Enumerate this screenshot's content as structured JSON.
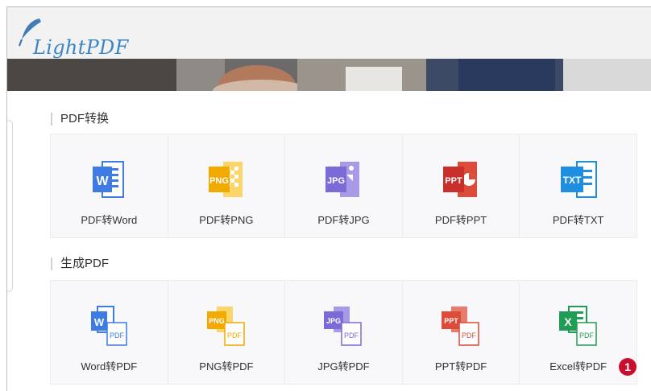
{
  "app": {
    "logo_text": "LightPDF"
  },
  "sections": [
    {
      "title": "PDF转换",
      "tiles": [
        {
          "label": "PDF转Word",
          "icon": "word-doc-icon",
          "color": "#3e7be3",
          "tag": "W"
        },
        {
          "label": "PDF转PNG",
          "icon": "png-image-icon",
          "color": "#f2a900",
          "tag": "PNG"
        },
        {
          "label": "PDF转JPG",
          "icon": "jpg-image-icon",
          "color": "#7b6bd6",
          "tag": "JPG"
        },
        {
          "label": "PDF转PPT",
          "icon": "ppt-slide-icon",
          "color": "#dd4b39",
          "tag": "PPT"
        },
        {
          "label": "PDF转TXT",
          "icon": "txt-file-icon",
          "color": "#1e8fe0",
          "tag": "TXT"
        }
      ]
    },
    {
      "title": "生成PDF",
      "tiles": [
        {
          "label": "Word转PDF",
          "icon": "word-to-pdf-icon",
          "color": "#3e7be3",
          "tag": "W",
          "sub": "PDF"
        },
        {
          "label": "PNG转PDF",
          "icon": "png-to-pdf-icon",
          "color": "#f2a900",
          "tag": "PNG",
          "sub": "PDF"
        },
        {
          "label": "JPG转PDF",
          "icon": "jpg-to-pdf-icon",
          "color": "#7b6bd6",
          "tag": "JPG",
          "sub": "PDF"
        },
        {
          "label": "PPT转PDF",
          "icon": "ppt-to-pdf-icon",
          "color": "#dd4b39",
          "tag": "PPT",
          "sub": "PDF"
        },
        {
          "label": "Excel转PDF",
          "icon": "excel-to-pdf-icon",
          "color": "#1f9d55",
          "tag": "X",
          "sub": "PDF"
        }
      ]
    }
  ],
  "badge": {
    "text": "1",
    "color": "#c8102e"
  }
}
